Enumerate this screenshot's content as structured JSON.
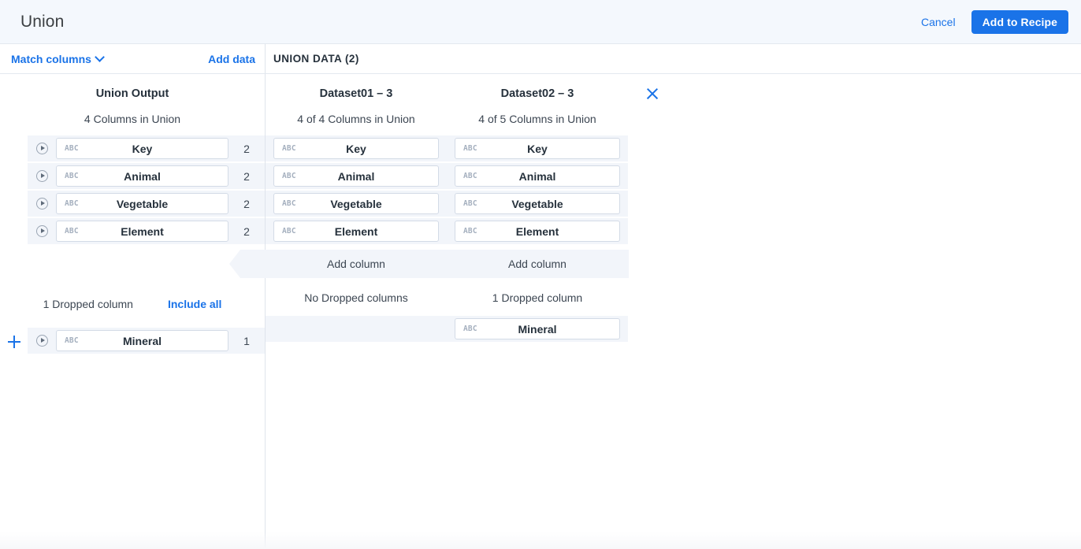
{
  "header": {
    "title": "Union",
    "cancel_label": "Cancel",
    "primary_label": "Add to Recipe"
  },
  "toolbar": {
    "match_columns_label": "Match columns",
    "match_columns_icon": "chevron-down-icon",
    "add_data_label": "Add data",
    "union_data_label": "UNION DATA (2)"
  },
  "union_output": {
    "title": "Union Output",
    "subtitle": "4 Columns in Union",
    "columns": [
      {
        "type": "ABC",
        "name": "Key",
        "count": "2"
      },
      {
        "type": "ABC",
        "name": "Animal",
        "count": "2"
      },
      {
        "type": "ABC",
        "name": "Vegetable",
        "count": "2"
      },
      {
        "type": "ABC",
        "name": "Element",
        "count": "2"
      }
    ],
    "dropped_label": "1 Dropped column",
    "include_all_label": "Include all",
    "dropped_columns": [
      {
        "type": "ABC",
        "name": "Mineral",
        "count": "1"
      }
    ],
    "add_icon": "plus-icon"
  },
  "datasets": [
    {
      "title": "Dataset01 – 3",
      "subtitle": "4 of 4 Columns in Union",
      "add_column_label": "Add column",
      "dropped_label": "No Dropped columns",
      "columns": [
        {
          "type": "ABC",
          "name": "Key"
        },
        {
          "type": "ABC",
          "name": "Animal"
        },
        {
          "type": "ABC",
          "name": "Vegetable"
        },
        {
          "type": "ABC",
          "name": "Element"
        }
      ],
      "dropped_columns": []
    },
    {
      "title": "Dataset02 – 3",
      "subtitle": "4 of 5 Columns in Union",
      "add_column_label": "Add column",
      "dropped_label": "1 Dropped column",
      "close_icon": "close-icon",
      "columns": [
        {
          "type": "ABC",
          "name": "Key"
        },
        {
          "type": "ABC",
          "name": "Animal"
        },
        {
          "type": "ABC",
          "name": "Vegetable"
        },
        {
          "type": "ABC",
          "name": "Element"
        }
      ],
      "dropped_columns": [
        {
          "type": "ABC",
          "name": "Mineral"
        }
      ]
    }
  ],
  "colors": {
    "accent": "#1a73e8",
    "row_bg": "#f2f5fa",
    "header_bg": "#f4f8fd",
    "text": "#26313c"
  }
}
